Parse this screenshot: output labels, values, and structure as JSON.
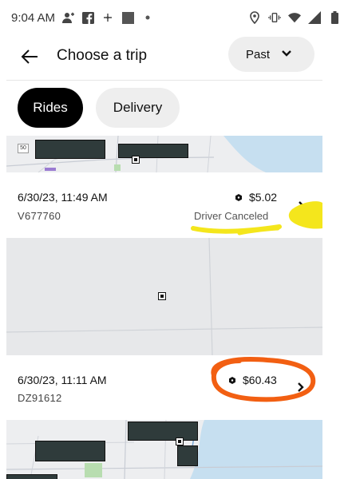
{
  "status_bar": {
    "time": "9:04 AM",
    "left_icons": [
      "person-add-icon",
      "facebook-icon",
      "sparkle-icon",
      "square-icon",
      "dot-icon"
    ],
    "right_icons": [
      "location-icon",
      "vibrate-icon",
      "wifi-icon",
      "cell-signal-icon",
      "battery-icon"
    ]
  },
  "header": {
    "title": "Choose a trip",
    "filter_label": "Past"
  },
  "tabs": [
    {
      "label": "Rides",
      "selected": true
    },
    {
      "label": "Delivery",
      "selected": false
    }
  ],
  "map_labels": {
    "route_shield": "50"
  },
  "trips": [
    {
      "date": "6/30/23, 11:49 AM",
      "id": "V677760",
      "price": "$5.02",
      "status": "Driver Canceled"
    },
    {
      "date": "6/30/23, 11:11 AM",
      "id": "DZ91612",
      "price": "$60.43",
      "status": ""
    }
  ],
  "colors": {
    "tab_selected_bg": "#000000",
    "tab_unselected_bg": "#eeeeee",
    "highlight_yellow": "#f4e61c",
    "annotation_orange": "#f25f12",
    "water": "#c6dff0",
    "redaction": "#2f3b3b"
  }
}
